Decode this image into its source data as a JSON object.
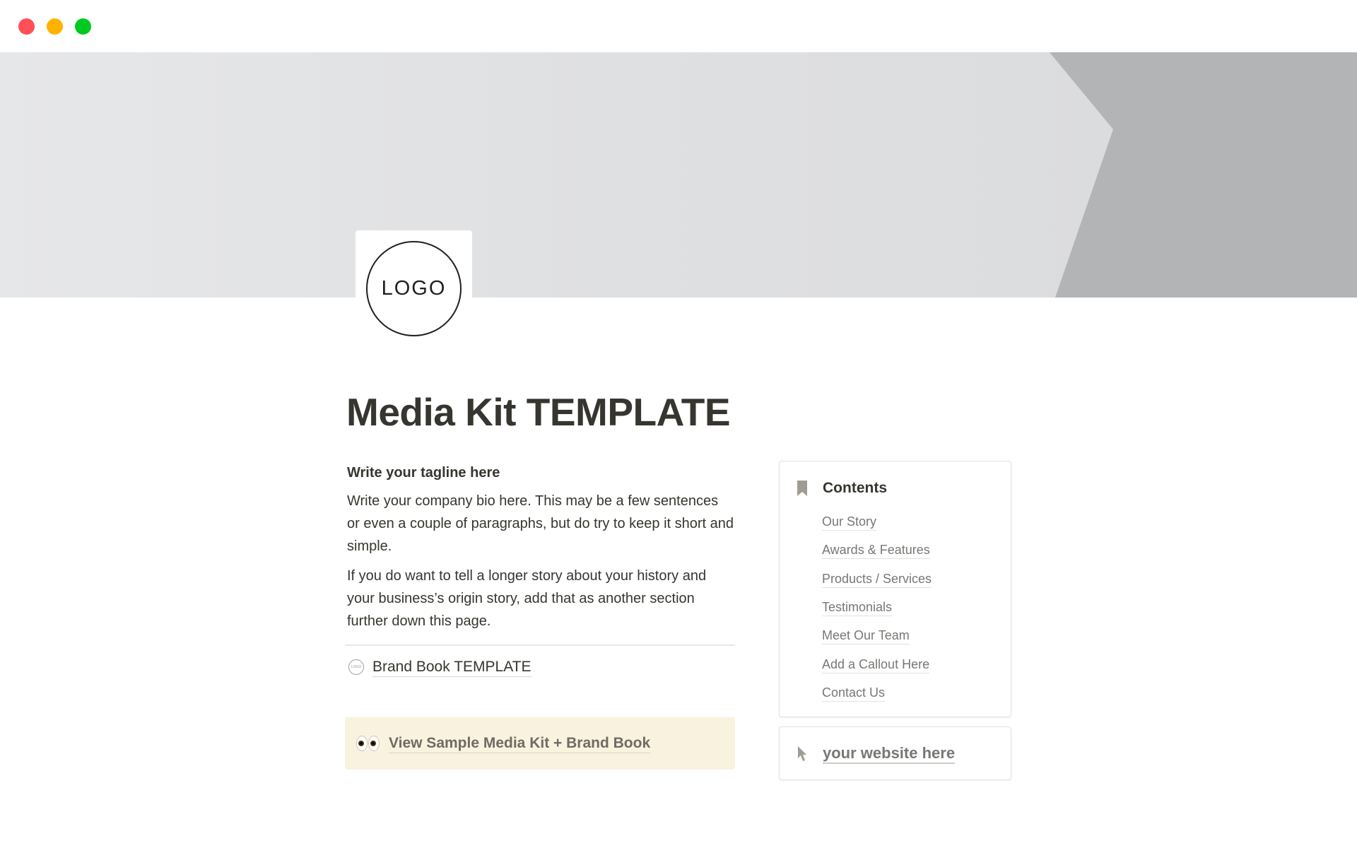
{
  "window": {
    "controls": [
      "close",
      "minimize",
      "zoom"
    ]
  },
  "cover": {
    "colors": {
      "light": "#e4e5e7",
      "dark": "#b3b4b6"
    }
  },
  "logo": {
    "text": "LOGO"
  },
  "page": {
    "title": "Media Kit TEMPLATE",
    "tagline": "Write your tagline here",
    "paragraphs": [
      "Write your company bio here. This may be a few sentences or even a couple of paragraphs, but do try to keep it short and simple.",
      "If you do want to tell a longer story about your history and your business’s origin story, add that as another section further down this page."
    ],
    "brand_book": {
      "icon": "logo-badge-icon",
      "icon_text": "LOGO",
      "label": "Brand Book TEMPLATE"
    },
    "callout": {
      "icon": "eyes-emoji-icon",
      "label": "View Sample Media Kit + Brand Book",
      "background": "#f9f2df"
    }
  },
  "contents": {
    "icon": "bookmark-icon",
    "title": "Contents",
    "items": [
      {
        "label": "Our Story"
      },
      {
        "label": "Awards & Features"
      },
      {
        "label": "Products / Services"
      },
      {
        "label": "Testimonials"
      },
      {
        "label": "Meet Our Team"
      },
      {
        "label": "Add a Callout Here"
      },
      {
        "label": "Contact Us"
      }
    ]
  },
  "website": {
    "icon": "cursor-arrow-icon",
    "label": "your website here"
  }
}
